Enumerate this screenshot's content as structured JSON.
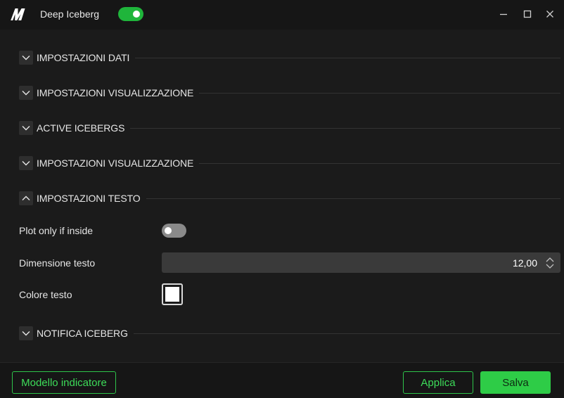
{
  "window": {
    "title": "Deep Iceberg",
    "enabled": true,
    "logo_icon": "brand-m-logo",
    "controls": [
      "minimize-icon",
      "maximize-icon",
      "close-icon"
    ]
  },
  "sections": [
    {
      "title": "IMPOSTAZIONI DATI",
      "expanded": false
    },
    {
      "title": "IMPOSTAZIONI VISUALIZZAZIONE",
      "expanded": false
    },
    {
      "title": "ACTIVE ICEBERGS",
      "expanded": false
    },
    {
      "title": "IMPOSTAZIONI VISUALIZZAZIONE",
      "expanded": false
    },
    {
      "title": "IMPOSTAZIONI TESTO",
      "expanded": true
    },
    {
      "title": "NOTIFICA ICEBERG",
      "expanded": false
    }
  ],
  "text_settings": {
    "plot_only_inside": {
      "label": "Plot only if inside",
      "value": false
    },
    "text_size": {
      "label": "Dimensione testo",
      "value": "12,00"
    },
    "text_color": {
      "label": "Colore testo",
      "value": "#ffffff"
    }
  },
  "footer": {
    "model_label": "Modello indicatore",
    "apply_label": "Applica",
    "save_label": "Salva"
  },
  "colors": {
    "accent": "#2ecc47",
    "background": "#1b1b1b",
    "titlebar": "#161616"
  }
}
